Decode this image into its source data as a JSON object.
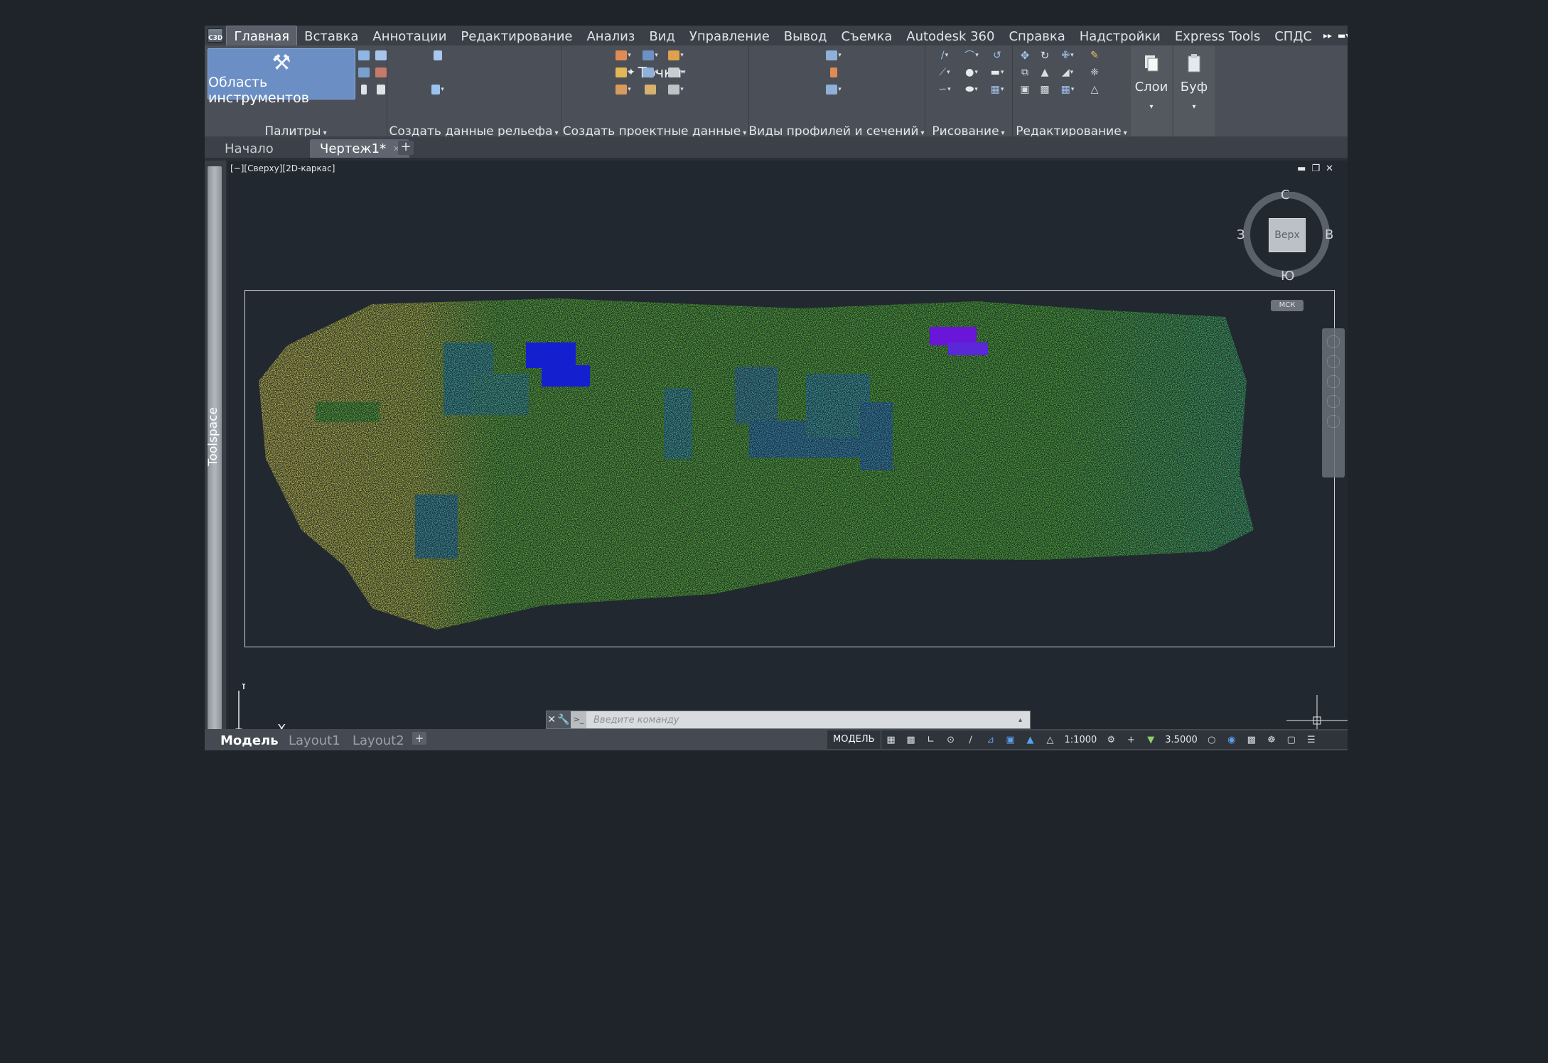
{
  "app": {
    "badge": "C3D"
  },
  "menu": {
    "items": [
      "Главная",
      "Вставка",
      "Аннотации",
      "Редактирование",
      "Анализ",
      "Вид",
      "Управление",
      "Вывод",
      "Съемка",
      "Autodesk 360",
      "Справка",
      "Надстройки",
      "Express Tools",
      "СПДС"
    ],
    "active_index": 0
  },
  "ribbon": {
    "toolspace_label": "Область инструментов",
    "points_label": "Точки",
    "layers_label": "Слои",
    "clipboard_label": "Буф",
    "panels": [
      "Палитры",
      "Создать данные рельефа",
      "Создать проектные данные",
      "Виды профилей и сечений",
      "Рисование",
      "Редактирование"
    ]
  },
  "file_tabs": {
    "start": "Начало",
    "drawing": "Чертеж1*"
  },
  "viewport": {
    "label": "[−][Сверху][2D-каркас]",
    "viewcube": {
      "north": "С",
      "south": "Ю",
      "west": "З",
      "east": "В",
      "face": "Верх"
    },
    "wcs_badge": "МСК",
    "ucs_x": "X",
    "ucs_y": "Y"
  },
  "toolspace": {
    "label": "Toolspace"
  },
  "command_line": {
    "placeholder": "Введите команду"
  },
  "layout_tabs": [
    "Модель",
    "Layout1",
    "Layout2"
  ],
  "status": {
    "mode": "МОДЕЛЬ",
    "scale": "1:1000",
    "elevation": "3.5000"
  },
  "colors": {
    "background": "#1f242b",
    "canvas": "#212830",
    "accent": "#6b8fc4",
    "cloud_yellow": "#e4d64a",
    "cloud_green": "#4fc62a",
    "cloud_cyan": "#38b7b0",
    "cloud_blue": "#1420d0",
    "cloud_purple": "#6a16d8"
  },
  "icons": [
    "toolspace-hammer-icon",
    "points-icon",
    "layers-icon",
    "clipboard-icon",
    "move-icon",
    "rotate-icon",
    "line-icon",
    "circle-icon",
    "navwheel-icon",
    "settings-gear-icon"
  ]
}
